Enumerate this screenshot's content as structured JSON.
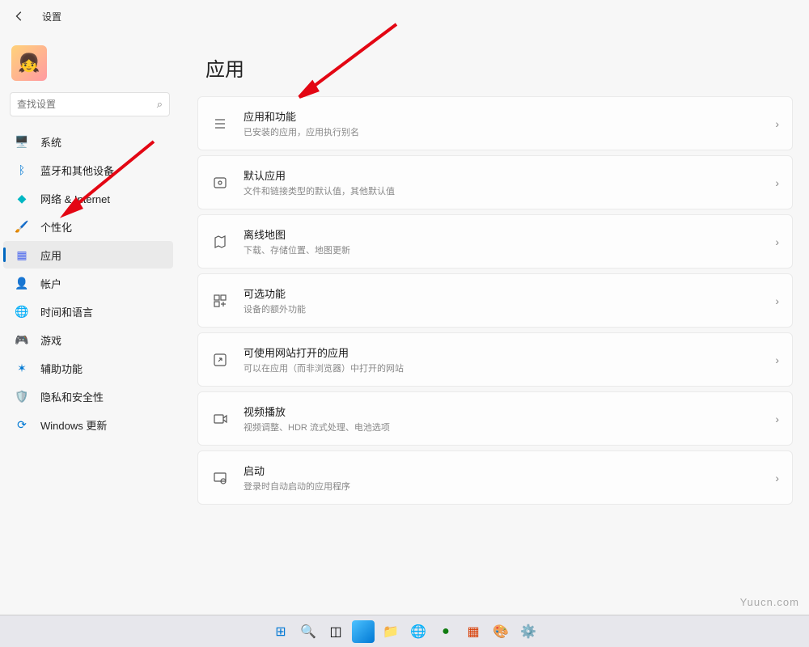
{
  "header": {
    "title": "设置"
  },
  "search": {
    "placeholder": "查找设置"
  },
  "sidebar": {
    "items": [
      {
        "label": "系统",
        "icon": "🖥️",
        "color": "#0078d4"
      },
      {
        "label": "蓝牙和其他设备",
        "icon": "ᛒ",
        "color": "#0078d4"
      },
      {
        "label": "网络 & Internet",
        "icon": "◆",
        "color": "#00b7c3"
      },
      {
        "label": "个性化",
        "icon": "🖌️",
        "color": "#e3008c"
      },
      {
        "label": "应用",
        "icon": "▦",
        "color": "#4f6bed"
      },
      {
        "label": "帐户",
        "icon": "👤",
        "color": "#107c10"
      },
      {
        "label": "时间和语言",
        "icon": "🌐",
        "color": "#0078d4"
      },
      {
        "label": "游戏",
        "icon": "🎮",
        "color": "#6b6b6b"
      },
      {
        "label": "辅助功能",
        "icon": "✶",
        "color": "#0078d4"
      },
      {
        "label": "隐私和安全性",
        "icon": "🛡️",
        "color": "#6b6b6b"
      },
      {
        "label": "Windows 更新",
        "icon": "⟳",
        "color": "#0078d4"
      }
    ]
  },
  "page": {
    "title": "应用"
  },
  "cards": [
    {
      "title": "应用和功能",
      "desc": "已安装的应用，应用执行别名"
    },
    {
      "title": "默认应用",
      "desc": "文件和链接类型的默认值，其他默认值"
    },
    {
      "title": "离线地图",
      "desc": "下载、存储位置、地图更新"
    },
    {
      "title": "可选功能",
      "desc": "设备的额外功能"
    },
    {
      "title": "可使用网站打开的应用",
      "desc": "可以在应用（而非浏览器）中打开的网站"
    },
    {
      "title": "视频播放",
      "desc": "视频调整、HDR 流式处理、电池选项"
    },
    {
      "title": "启动",
      "desc": "登录时自动启动的应用程序"
    }
  ],
  "watermark": "Yuucn.com"
}
